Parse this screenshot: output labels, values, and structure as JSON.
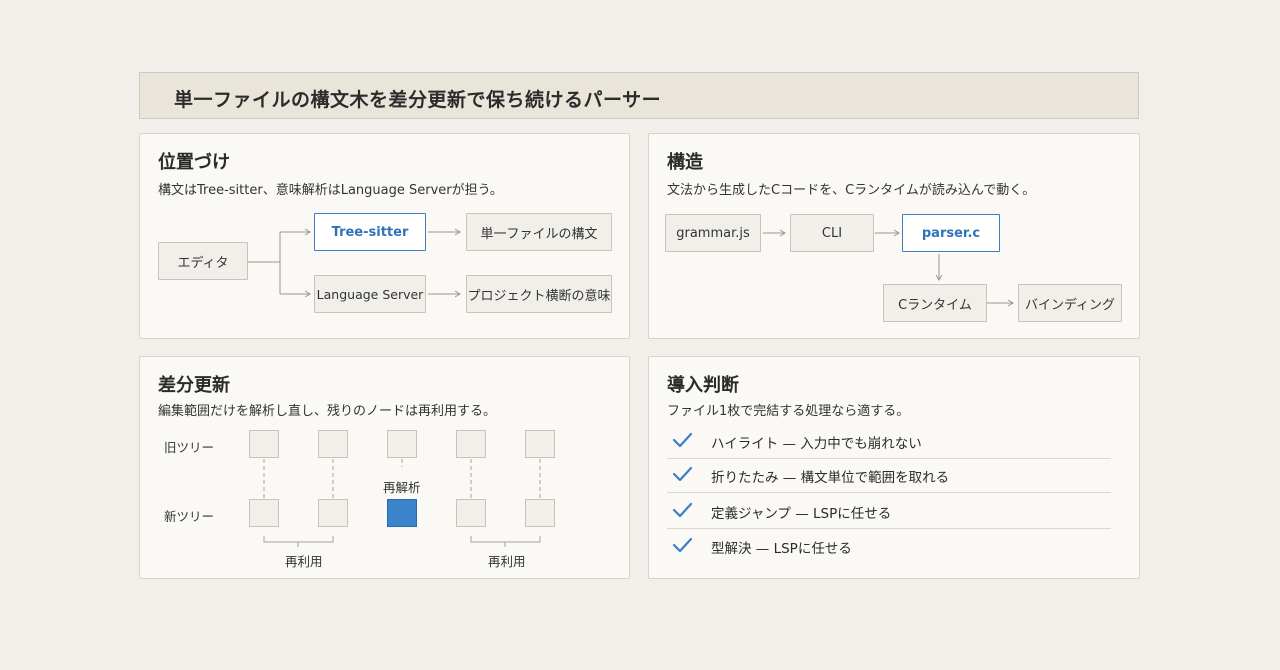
{
  "title": "単一ファイルの構文木を差分更新で保ち続けるパーサー",
  "positioning": {
    "heading": "位置づけ",
    "subtitle": "構文はTree-sitter、意味解析はLanguage Serverが担う。",
    "nodes": {
      "editor": "エディタ",
      "tree_sitter": "Tree-sitter",
      "single_file_syntax": "単一ファイルの構文",
      "language_server": "Language Server",
      "project_semantics": "プロジェクト横断の意味"
    }
  },
  "structure": {
    "heading": "構造",
    "subtitle": "文法から生成したCコードを、Cランタイムが読み込んで動く。",
    "nodes": {
      "grammar": "grammar.js",
      "cli": "CLI",
      "parser": "parser.c",
      "runtime": "Cランタイム",
      "bindings": "バインディング"
    }
  },
  "incremental": {
    "heading": "差分更新",
    "subtitle": "編集範囲だけを解析し直し、残りのノードは再利用する。",
    "old_tree_label": "旧ツリー",
    "new_tree_label": "新ツリー",
    "reparse_label": "再解析",
    "reuse_left_label": "再利用",
    "reuse_right_label": "再利用"
  },
  "adoption": {
    "heading": "導入判断",
    "subtitle": "ファイル1枚で完結する処理なら適する。",
    "items": [
      "ハイライト — 入力中でも崩れない",
      "折りたたみ — 構文単位で範囲を取れる",
      "定義ジャンプ — LSPに任せる",
      "型解決 — LSPに任せる"
    ]
  },
  "colors": {
    "accent": "#3a7fc4",
    "background": "#f1efe9",
    "panel": "#faf9f6"
  }
}
